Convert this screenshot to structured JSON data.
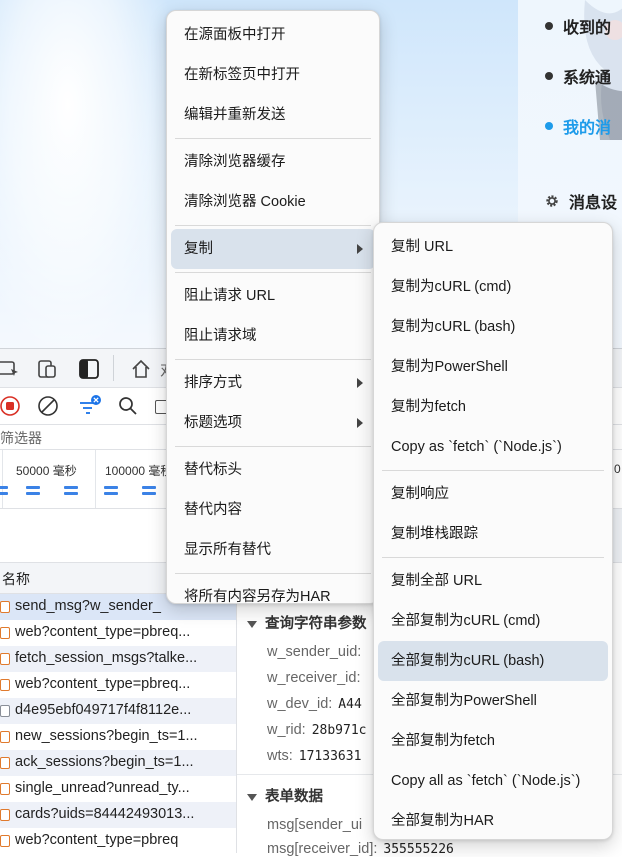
{
  "background": {
    "nav_items": [
      {
        "label": "收到的",
        "active": false
      },
      {
        "label": "系统通",
        "active": false
      },
      {
        "label": "我的消",
        "active": true
      }
    ],
    "settings_label": "消息设",
    "accent_color": "#1d9bea"
  },
  "devtools": {
    "toolbar_partial_text": "对",
    "filter_placeholder": "筛选器",
    "timeline_ticks": [
      "50000 毫秒",
      "100000 毫秒",
      "0"
    ],
    "column_header_name": "名称",
    "requests": [
      "send_msg?w_sender_",
      "web?content_type=pbreq...",
      "fetch_session_msgs?talke...",
      "web?content_type=pbreq...",
      "d4e95ebf049717f4f8112e...",
      "new_sessions?begin_ts=1...",
      "ack_sessions?begin_ts=1...",
      "single_unread?unread_ty...",
      "cards?uids=84442493013...",
      "web?content_type=pbreq"
    ],
    "detail": {
      "query_section_title": "查询字符串参数",
      "params": [
        {
          "key": "w_sender_uid:",
          "value": ""
        },
        {
          "key": "w_receiver_id:",
          "value": ""
        },
        {
          "key": "w_dev_id:",
          "value": "A44"
        },
        {
          "key": "w_rid:",
          "value": "28b971c"
        },
        {
          "key": "wts:",
          "value": "17133631"
        }
      ],
      "form_section_title": "表单数据",
      "form_params": [
        {
          "key": "msg[sender_ui",
          "value": ""
        },
        {
          "key": "msg[receiver_id]:",
          "value": "355555226"
        }
      ]
    }
  },
  "context_menu": {
    "items": [
      {
        "label": "在源面板中打开",
        "type": "item"
      },
      {
        "label": "在新标签页中打开",
        "type": "item"
      },
      {
        "label": "编辑并重新发送",
        "type": "item"
      },
      {
        "type": "sep"
      },
      {
        "label": "清除浏览器缓存",
        "type": "item"
      },
      {
        "label": "清除浏览器 Cookie",
        "type": "item"
      },
      {
        "type": "sep"
      },
      {
        "label": "复制",
        "type": "submenu",
        "highlighted": true
      },
      {
        "type": "sep"
      },
      {
        "label": "阻止请求 URL",
        "type": "item"
      },
      {
        "label": "阻止请求域",
        "type": "item"
      },
      {
        "type": "sep"
      },
      {
        "label": "排序方式",
        "type": "submenu"
      },
      {
        "label": "标题选项",
        "type": "submenu"
      },
      {
        "type": "sep"
      },
      {
        "label": "替代标头",
        "type": "item"
      },
      {
        "label": "替代内容",
        "type": "item"
      },
      {
        "label": "显示所有替代",
        "type": "item"
      },
      {
        "type": "sep"
      },
      {
        "label": "将所有内容另存为HAR",
        "type": "item"
      }
    ]
  },
  "copy_submenu": {
    "items": [
      {
        "label": "复制 URL",
        "type": "item"
      },
      {
        "label": "复制为cURL (cmd)",
        "type": "item"
      },
      {
        "label": "复制为cURL (bash)",
        "type": "item"
      },
      {
        "label": "复制为PowerShell",
        "type": "item"
      },
      {
        "label": "复制为fetch",
        "type": "item"
      },
      {
        "label": "Copy as `fetch` (`Node.js`)",
        "type": "item"
      },
      {
        "type": "sep"
      },
      {
        "label": "复制响应",
        "type": "item"
      },
      {
        "label": "复制堆栈跟踪",
        "type": "item"
      },
      {
        "type": "sep"
      },
      {
        "label": "复制全部 URL",
        "type": "item"
      },
      {
        "label": "全部复制为cURL (cmd)",
        "type": "item"
      },
      {
        "label": "全部复制为cURL (bash)",
        "type": "item",
        "highlighted": true
      },
      {
        "label": "全部复制为PowerShell",
        "type": "item"
      },
      {
        "label": "全部复制为fetch",
        "type": "item"
      },
      {
        "label": "Copy all as `fetch` (`Node.js`)",
        "type": "item"
      },
      {
        "label": "全部复制为HAR",
        "type": "item"
      }
    ]
  },
  "colors": {
    "menu_highlight": "#d9e2ec",
    "selected_row": "#dbe6f7",
    "record_button": "#d93025"
  }
}
